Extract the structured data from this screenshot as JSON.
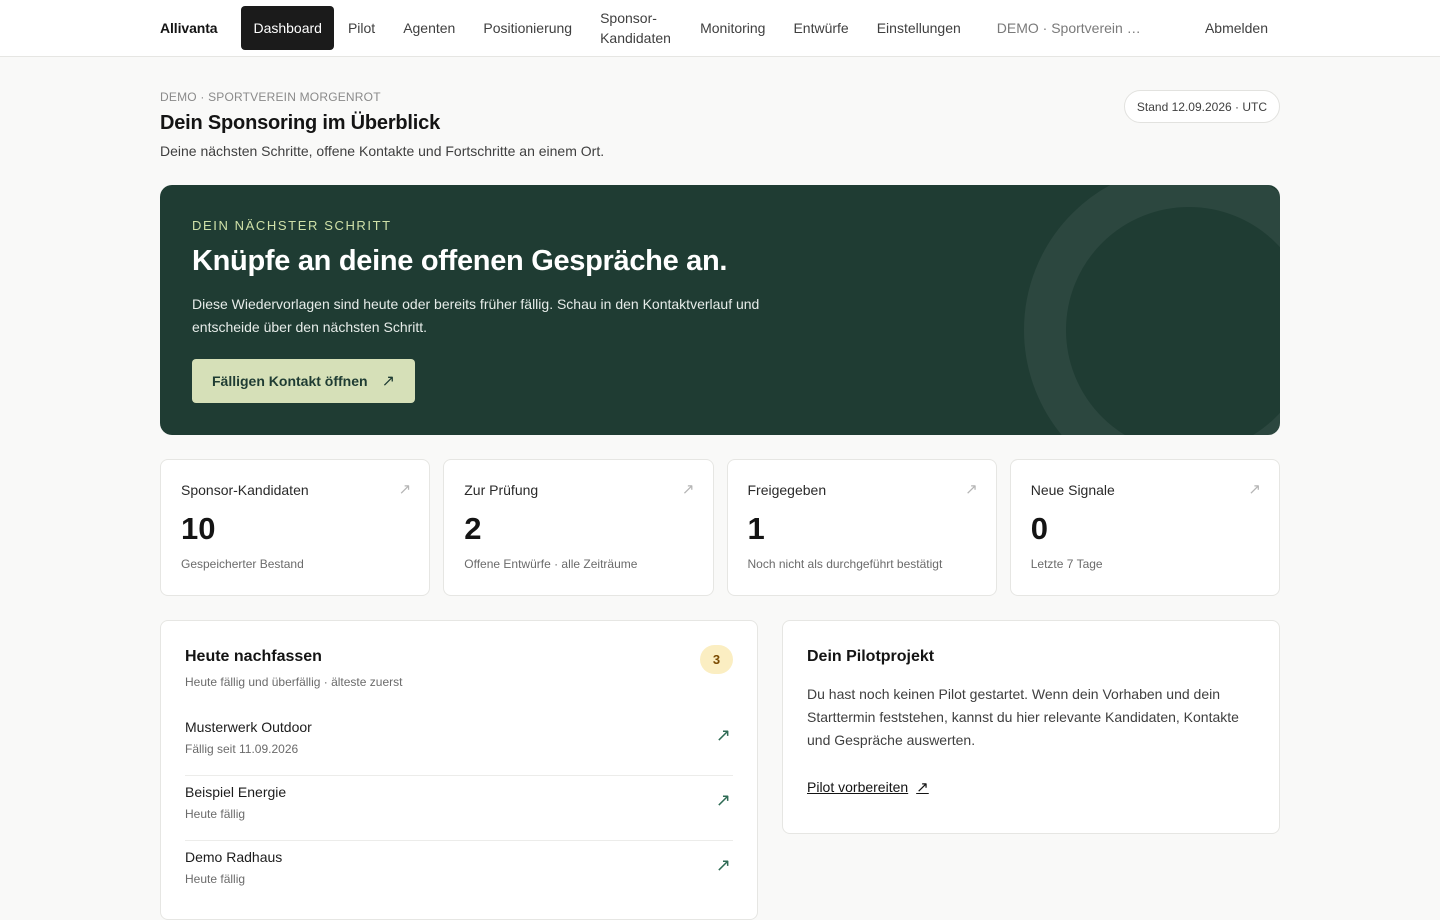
{
  "nav": {
    "brand": "Allivanta",
    "items": [
      {
        "label": "Dashboard",
        "active": true
      },
      {
        "label": "Pilot"
      },
      {
        "label": "Agenten"
      },
      {
        "label": "Positionierung"
      },
      {
        "label": "Sponsor-Kandidaten"
      },
      {
        "label": "Monitoring"
      },
      {
        "label": "Entwürfe"
      },
      {
        "label": "Einstellungen"
      }
    ],
    "org": "DEMO · Sportverein M...",
    "logout": "Abmelden"
  },
  "header": {
    "eyebrow": "DEMO · SPORTVEREIN MORGENROT",
    "title": "Dein Sponsoring im Überblick",
    "subtitle": "Deine nächsten Schritte, offene Kontakte und Fortschritte an einem Ort.",
    "stand": "Stand 12.09.2026 · UTC"
  },
  "hero": {
    "kicker": "DEIN NÄCHSTER SCHRITT",
    "title": "Knüpfe an deine offenen Gespräche an.",
    "text": "Diese Wiedervorlagen sind heute oder bereits früher fällig. Schau in den Kontaktverlauf und entscheide über den nächsten Schritt.",
    "cta": "Fälligen Kontakt öffnen"
  },
  "kpis": [
    {
      "label": "Sponsor-Kandidaten",
      "value": "10",
      "note": "Gespeicherter Bestand"
    },
    {
      "label": "Zur Prüfung",
      "value": "2",
      "note": "Offene Entwürfe · alle Zeiträume"
    },
    {
      "label": "Freigegeben",
      "value": "1",
      "note": "Noch nicht als durchgeführt bestätigt"
    },
    {
      "label": "Neue Signale",
      "value": "0",
      "note": "Letzte 7 Tage"
    }
  ],
  "followup": {
    "title": "Heute nachfassen",
    "subtitle": "Heute fällig und überfällig · älteste zuerst",
    "count": "3",
    "items": [
      {
        "name": "Musterwerk Outdoor",
        "due": "Fällig seit 11.09.2026"
      },
      {
        "name": "Beispiel Energie",
        "due": "Heute fällig"
      },
      {
        "name": "Demo Radhaus",
        "due": "Heute fällig"
      }
    ]
  },
  "pilot": {
    "title": "Dein Pilotprojekt",
    "text": "Du hast noch keinen Pilot gestartet. Wenn dein Vorhaben und dein Starttermin feststehen, kannst du hier relevante Kandidaten, Kontakte und Gespräche auswerten.",
    "link": "Pilot vorbereiten"
  },
  "icons": {
    "arrow": "↗"
  }
}
